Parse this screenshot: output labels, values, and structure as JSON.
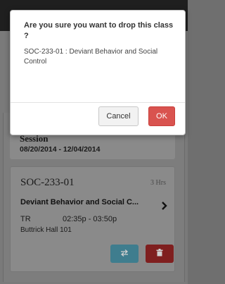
{
  "dialog": {
    "title": "Are you sure you want to drop this class ?",
    "message": "SOC-233-01 : Deviant Behavior and Social Control",
    "cancel_label": "Cancel",
    "ok_label": "OK"
  },
  "session": {
    "label": "Session",
    "dates": "08/20/2014 - 12/04/2014"
  },
  "course": {
    "code": "SOC-233-01",
    "hours": "3 Hrs",
    "title": "Deviant Behavior and Social C...",
    "days": "TR",
    "time": "02:35p - 03:50p",
    "location": "Buttrick Hall 101",
    "chevron_icon": "chevron-right-icon",
    "swap_icon": "swap-arrows-icon",
    "drop_icon": "trash-icon"
  },
  "colors": {
    "ok_button": "#d9534f",
    "swap_button_dimmed": "#3f7d8e",
    "drop_button_dimmed": "#7f1f1f"
  }
}
